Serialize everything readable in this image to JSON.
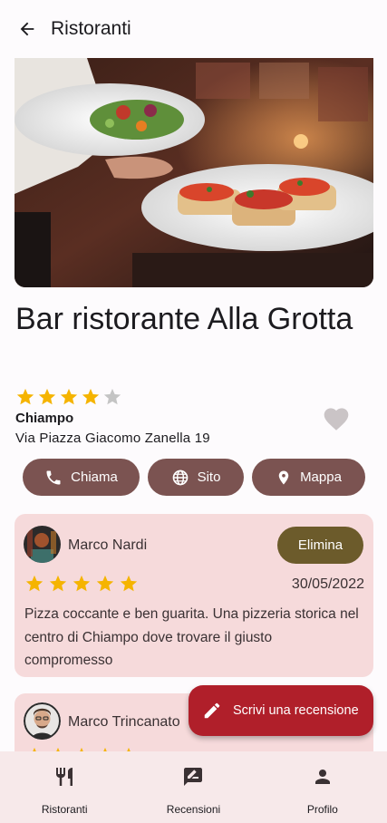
{
  "topbar": {
    "title": "Ristoranti",
    "back_icon": "arrow-back-icon"
  },
  "restaurant": {
    "name": "Bar ristorante Alla Grotta",
    "rating": 4,
    "rating_max": 5,
    "city": "Chiampo",
    "address": "Via Piazza Giacomo Zanella 19",
    "favorite": false
  },
  "actions": [
    {
      "label": "Chiama",
      "icon": "phone-icon"
    },
    {
      "label": "Sito",
      "icon": "globe-icon"
    },
    {
      "label": "Mappa",
      "icon": "map-pin-icon"
    }
  ],
  "reviews": [
    {
      "author": "Marco Nardi",
      "rating": 5,
      "date": "30/05/2022",
      "text": "Pizza coccante e ben guarita. Una pizzeria storica nel centro di Chiampo dove trovare il giusto compromesso",
      "delete_label": "Elimina"
    },
    {
      "author": "Marco Trincanato",
      "rating": 5
    }
  ],
  "fab": {
    "label": "Scrivi una recensione",
    "icon": "pencil-icon"
  },
  "bottom_nav": [
    {
      "label": "Ristoranti",
      "icon": "fork-knife-icon"
    },
    {
      "label": "Recensioni",
      "icon": "rate-review-icon"
    },
    {
      "label": "Profilo",
      "icon": "person-icon"
    }
  ],
  "colors": {
    "star": "#f5b400",
    "star_empty": "#c4c4c4",
    "action_button": "#7b5351",
    "review_card": "#f6dadb",
    "delete_button": "#6c5b2b",
    "fab": "#b01f2a",
    "bottom_nav": "#f7e9ea"
  }
}
